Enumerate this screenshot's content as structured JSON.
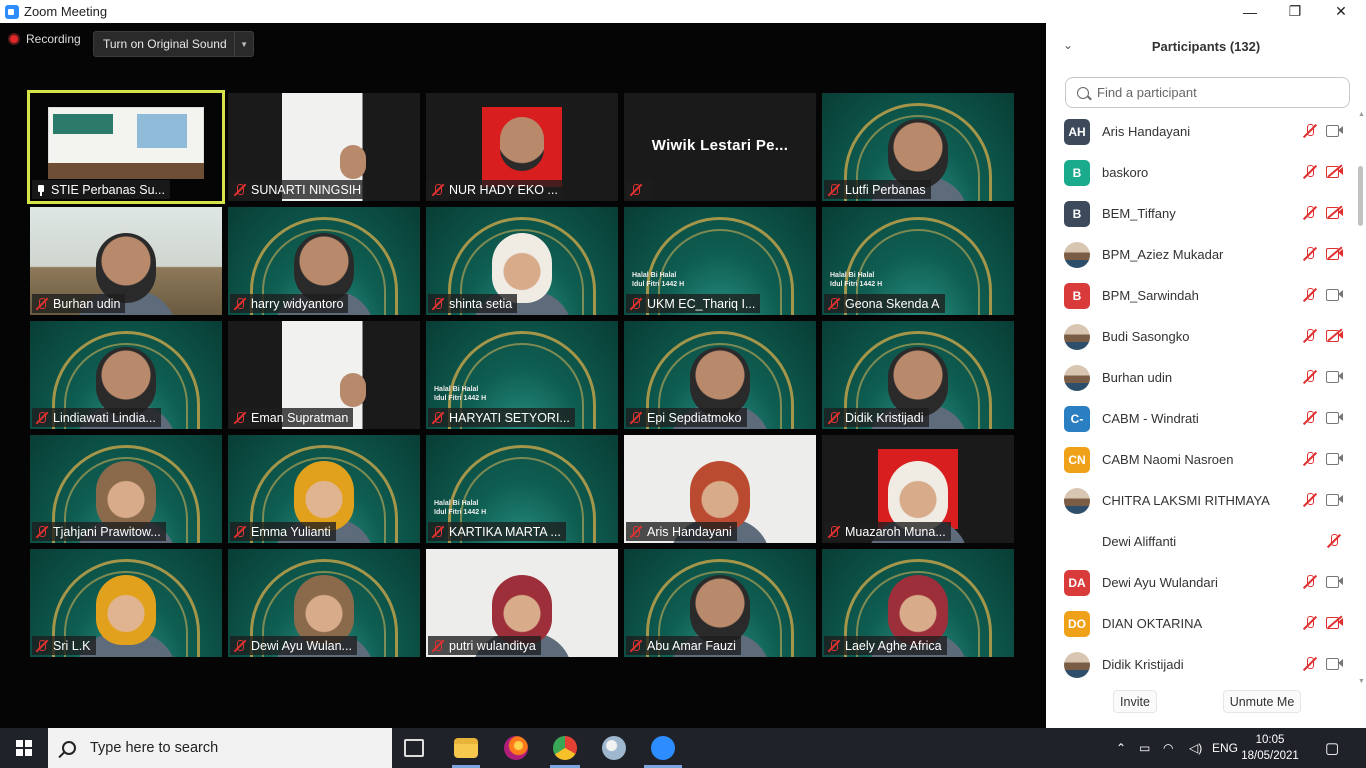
{
  "window": {
    "title": "Zoom Meeting",
    "controls": {
      "minimize": "—",
      "maximize": "❐",
      "close": "✕"
    }
  },
  "meeting": {
    "recording_label": "Recording",
    "sound_button_label": "Turn on Original Sound"
  },
  "tiles": [
    {
      "name": "STIE Perbanas Su...",
      "muted": false,
      "pinned": true,
      "active": true,
      "style": "stage"
    },
    {
      "name": "SUNARTI NINGSIH",
      "muted": true,
      "style": "white"
    },
    {
      "name": "NUR HADY EKO ...",
      "muted": true,
      "style": "red"
    },
    {
      "name": "",
      "muted": true,
      "style": "dark",
      "big_name": "Wiwik Lestari Pe..."
    },
    {
      "name": "Lutfi Perbanas",
      "muted": true,
      "style": "green",
      "face": "man"
    },
    {
      "name": "Burhan udin",
      "muted": true,
      "style": "room",
      "face": "man"
    },
    {
      "name": "harry widyantoro",
      "muted": true,
      "style": "green",
      "face": "man"
    },
    {
      "name": "shinta setia",
      "muted": true,
      "style": "green",
      "face": "hijab-w"
    },
    {
      "name": "UKM EC_Thariq I...",
      "muted": true,
      "style": "green"
    },
    {
      "name": "Geona Skenda A",
      "muted": true,
      "style": "green"
    },
    {
      "name": "Lindiawati Lindia...",
      "muted": false,
      "style": "green",
      "face": "man"
    },
    {
      "name": "Eman Supratman",
      "muted": true,
      "style": "white"
    },
    {
      "name": "HARYATI SETYORI...",
      "muted": true,
      "style": "green"
    },
    {
      "name": "Epi Sepdiatmoko",
      "muted": true,
      "style": "green",
      "face": "man"
    },
    {
      "name": "Didik Kristijadi",
      "muted": true,
      "style": "green",
      "face": "man"
    },
    {
      "name": "Tjahjani Prawitow...",
      "muted": true,
      "style": "green",
      "face": "hijab"
    },
    {
      "name": "Emma Yulianti",
      "muted": true,
      "style": "green",
      "face": "hijab-o"
    },
    {
      "name": "KARTIKA MARTA ...",
      "muted": true,
      "style": "green"
    },
    {
      "name": "Aris Handayani",
      "muted": true,
      "style": "plain",
      "face": "hijab-b"
    },
    {
      "name": "Muazaroh Muna...",
      "muted": true,
      "style": "red",
      "face": "hijab-w"
    },
    {
      "name": "Sri L.K",
      "muted": true,
      "style": "green",
      "face": "hijab-o"
    },
    {
      "name": "Dewi Ayu Wulan...",
      "muted": true,
      "style": "green",
      "face": "hijab"
    },
    {
      "name": "putri wulanditya",
      "muted": true,
      "style": "plain",
      "face": "hijab-r"
    },
    {
      "name": "Abu Amar Fauzi",
      "muted": true,
      "style": "green",
      "face": "man"
    },
    {
      "name": "Laely Aghe Africa",
      "muted": true,
      "style": "green",
      "face": "hijab-r"
    }
  ],
  "tile_greeting": "Halal Bi Halal\nIdul Fitri 1442 H",
  "participants": {
    "title": "Participants (132)",
    "search_placeholder": "Find a participant",
    "list": [
      {
        "initials": "AH",
        "color": "#3d4a5c",
        "name": "Aris Handayani",
        "video_off": false
      },
      {
        "initials": "B",
        "color": "#1aaa8c",
        "name": "baskoro",
        "video_off": true
      },
      {
        "initials": "B",
        "color": "#3d4a5c",
        "name": "BEM_Tiffany",
        "video_off": true
      },
      {
        "initials": "",
        "color": "photo",
        "name": "BPM_Aziez Mukadar",
        "video_off": true
      },
      {
        "initials": "B",
        "color": "#d93a3a",
        "name": "BPM_Sarwindah",
        "video_off": false
      },
      {
        "initials": "",
        "color": "photo",
        "name": "Budi Sasongko",
        "video_off": true
      },
      {
        "initials": "",
        "color": "photo",
        "name": "Burhan udin",
        "video_off": false
      },
      {
        "initials": "C-",
        "color": "#2a7ec2",
        "name": "CABM - Windrati",
        "video_off": false
      },
      {
        "initials": "CN",
        "color": "#f0a11a",
        "name": "CABM Naomi Nasroen",
        "video_off": false
      },
      {
        "initials": "",
        "color": "photo",
        "name": "CHITRA LAKSMI RITHMAYA",
        "video_off": false
      },
      {
        "initials": "",
        "color": "none",
        "name": "Dewi Aliffanti",
        "video_off": null
      },
      {
        "initials": "DA",
        "color": "#d93a3a",
        "name": "Dewi Ayu Wulandari",
        "video_off": false
      },
      {
        "initials": "DO",
        "color": "#f0a11a",
        "name": "DIAN OKTARINA",
        "video_off": true
      },
      {
        "initials": "",
        "color": "photo",
        "name": "Didik Kristijadi",
        "video_off": false
      }
    ],
    "invite_label": "Invite",
    "unmute_label": "Unmute Me"
  },
  "taskbar": {
    "search_text": "Type here to search",
    "language": "ENG",
    "time": "10:05",
    "date": "18/05/2021"
  }
}
